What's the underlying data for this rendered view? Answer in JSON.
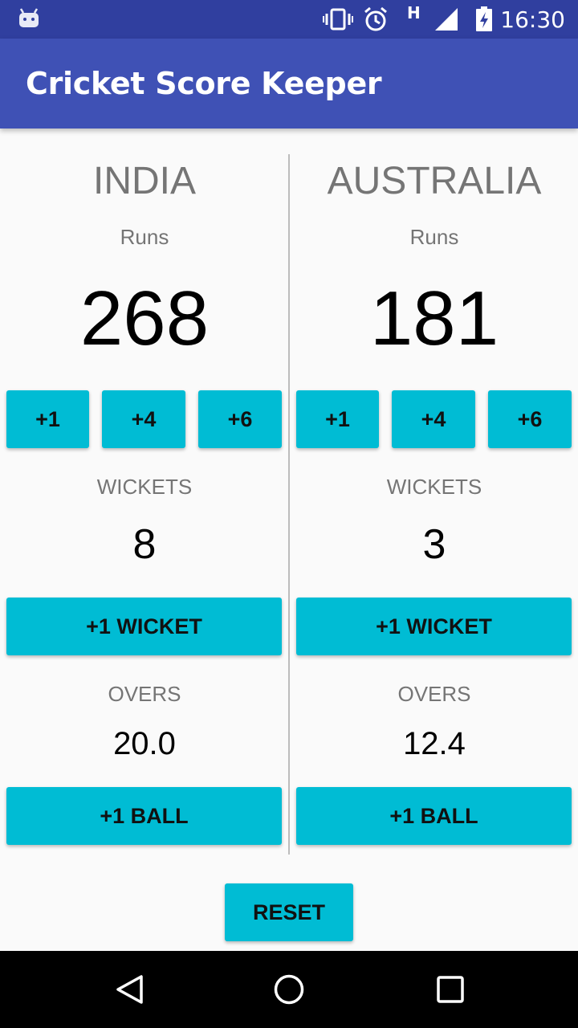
{
  "status_bar": {
    "time": "16:30",
    "network_label": "H",
    "icons": [
      "android-icon",
      "vibrate-icon",
      "alarm-icon",
      "signal-icon",
      "battery-charging-icon"
    ]
  },
  "app_bar": {
    "title": "Cricket Score Keeper"
  },
  "teams": [
    {
      "name": "INDIA",
      "runs_label": "Runs",
      "runs": "268",
      "run_buttons": [
        "+1",
        "+4",
        "+6"
      ],
      "wickets_label": "WICKETS",
      "wickets": "8",
      "wicket_button": "+1 WICKET",
      "overs_label": "OVERS",
      "overs": "20.0",
      "ball_button": "+1 BALL"
    },
    {
      "name": "AUSTRALIA",
      "runs_label": "Runs",
      "runs": "181",
      "run_buttons": [
        "+1",
        "+4",
        "+6"
      ],
      "wickets_label": "WICKETS",
      "wickets": "3",
      "wicket_button": "+1 WICKET",
      "overs_label": "OVERS",
      "overs": "12.4",
      "ball_button": "+1 BALL"
    }
  ],
  "reset_label": "RESET",
  "nav_bar": {
    "icons": [
      "back-icon",
      "home-icon",
      "recents-icon"
    ]
  },
  "colors": {
    "status_bar": "#303F9F",
    "app_bar": "#3F51B5",
    "button": "#00BCD4",
    "background": "#FAFAFA"
  }
}
